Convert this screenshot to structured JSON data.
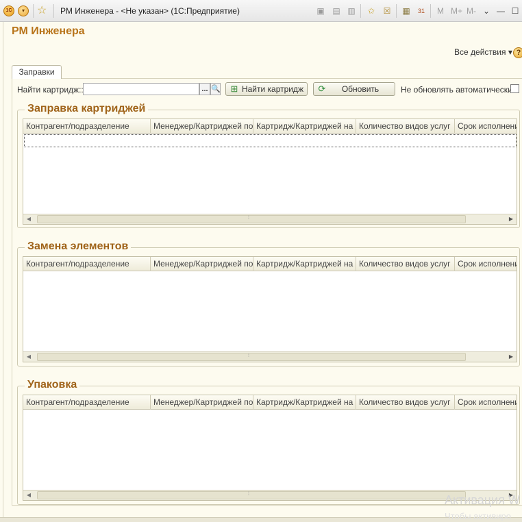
{
  "window": {
    "title": "РМ Инженера -  <Не указан>  (1С:Предприятие)",
    "toolbar_text_buttons": [
      "M",
      "M+",
      "M-"
    ]
  },
  "page": {
    "title": "РМ Инженера",
    "all_actions": "Все действия",
    "help": "?"
  },
  "tabs": [
    {
      "label": "Заправки"
    }
  ],
  "search": {
    "label": "Найти картридж::",
    "value": "",
    "dots": "...",
    "find_button": "Найти картридж",
    "refresh_button": "Обновить",
    "no_auto_refresh_label": "Не обновлять автоматически:"
  },
  "columns": [
    "Контрагент/подразделение",
    "Менеджер/Картриджей по...",
    "Картридж/Картриджей на ...",
    "Количество видов услуг",
    "Срок исполнения"
  ],
  "groups": [
    {
      "title": "Заправка картриджей"
    },
    {
      "title": "Замена элементов"
    },
    {
      "title": "Упаковка"
    }
  ],
  "watermark": {
    "line1": "Активация W",
    "line2": "Чтобы активиро"
  },
  "colors": {
    "title_accent": "#b8741a",
    "group_title": "#a0641a",
    "background": "#fdfbef"
  }
}
